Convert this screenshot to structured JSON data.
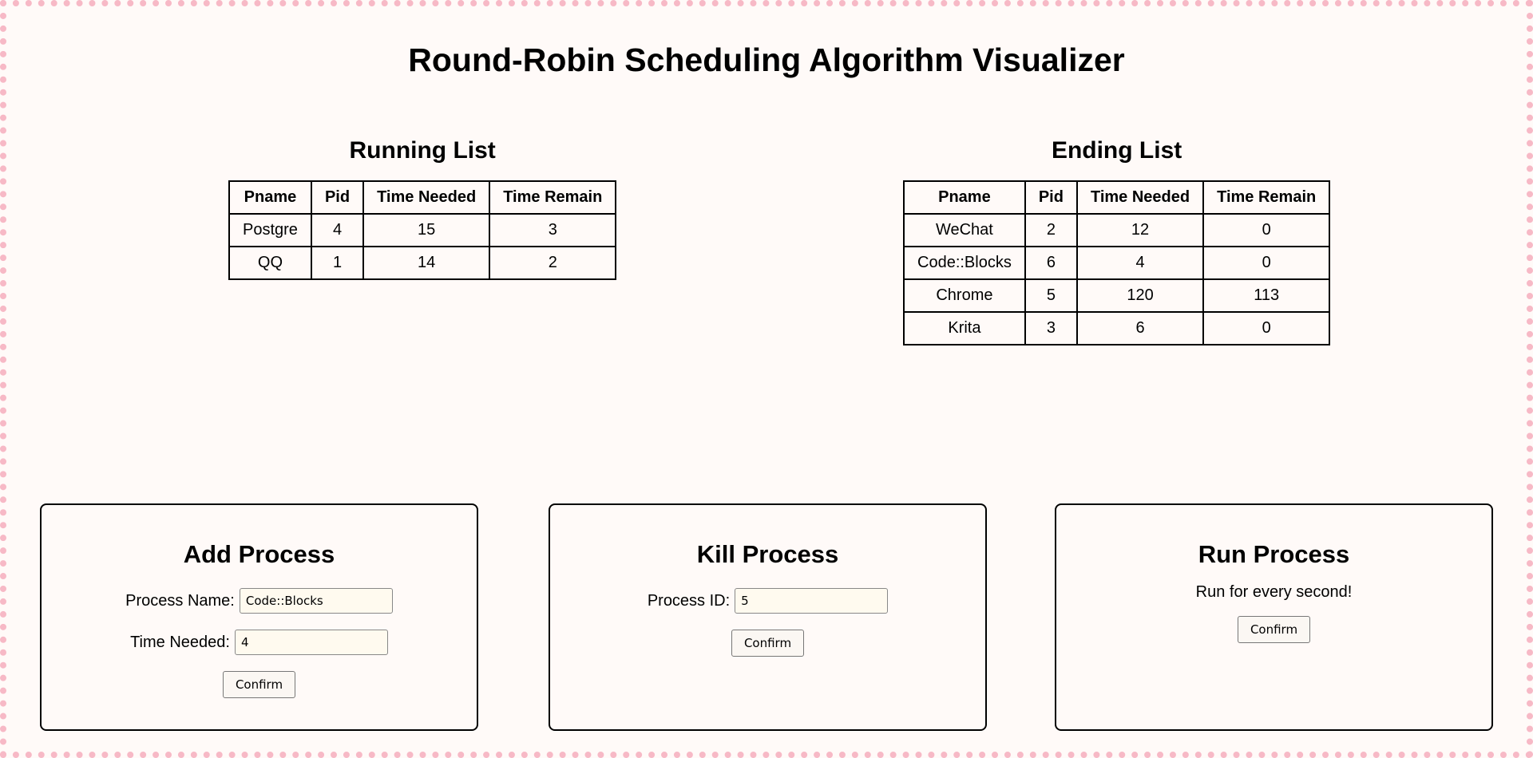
{
  "title": "Round-Robin Scheduling Algorithm Visualizer",
  "table_headers": [
    "Pname",
    "Pid",
    "Time Needed",
    "Time Remain"
  ],
  "running": {
    "heading": "Running List",
    "rows": [
      [
        "Postgre",
        "4",
        "15",
        "3"
      ],
      [
        "QQ",
        "1",
        "14",
        "2"
      ]
    ]
  },
  "ending": {
    "heading": "Ending List",
    "rows": [
      [
        "WeChat",
        "2",
        "12",
        "0"
      ],
      [
        "Code::Blocks",
        "6",
        "4",
        "0"
      ],
      [
        "Chrome",
        "5",
        "120",
        "113"
      ],
      [
        "Krita",
        "3",
        "6",
        "0"
      ]
    ]
  },
  "add_process": {
    "heading": "Add Process",
    "name_label": "Process Name:",
    "name_value": "Code::Blocks",
    "time_label": "Time Needed:",
    "time_value": "4",
    "confirm_label": "Confirm"
  },
  "kill_process": {
    "heading": "Kill Process",
    "id_label": "Process ID:",
    "id_value": "5",
    "confirm_label": "Confirm"
  },
  "run_process": {
    "heading": "Run Process",
    "description": "Run for every second!",
    "confirm_label": "Confirm"
  },
  "colors": {
    "background": "#fffaf8",
    "border_dots": "#f7b9c6",
    "input_bg": "#fffaef"
  }
}
